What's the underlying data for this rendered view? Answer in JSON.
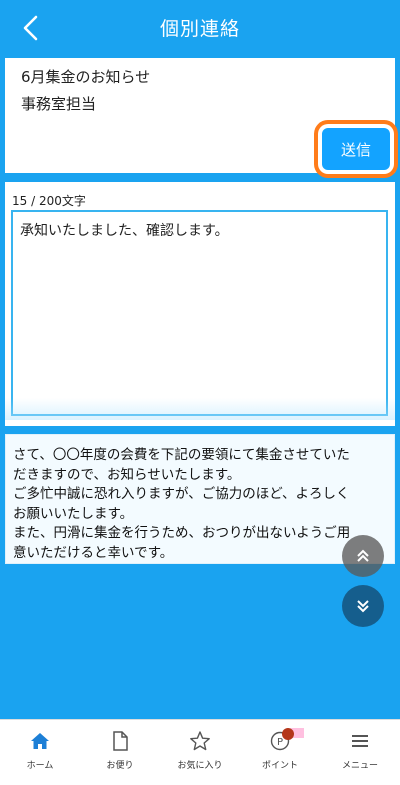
{
  "header": {
    "title": "個別連絡"
  },
  "message": {
    "title": "6月集金のお知らせ",
    "sender": "事務室担当",
    "send_label": "送信"
  },
  "compose": {
    "counter": "15 / 200文字",
    "text": "承知いたしました、確認します。"
  },
  "notice": {
    "lines": [
      "さて、〇〇年度の会費を下記の要領にて集金させていた",
      "だきますので、お知らせいたします。",
      "ご多忙中誠に恐れ入りますが、ご協力のほど、よろしく",
      "お願いいたします。",
      "また、円滑に集金を行うため、おつりが出ないようご用",
      "意いただけると幸いです。"
    ]
  },
  "bottom_nav": {
    "items": [
      {
        "label": "ホーム",
        "icon": "home-icon",
        "active": true
      },
      {
        "label": "お便り",
        "icon": "document-icon"
      },
      {
        "label": "お気に入り",
        "icon": "star-icon"
      },
      {
        "label": "ポイント",
        "icon": "points-icon"
      },
      {
        "label": "メニュー",
        "icon": "menu-icon"
      }
    ]
  },
  "colors": {
    "primary": "#1aa3f0",
    "button": "#13a3ff",
    "highlight": "#ff7c1a",
    "active_nav": "#1d7fd6"
  }
}
